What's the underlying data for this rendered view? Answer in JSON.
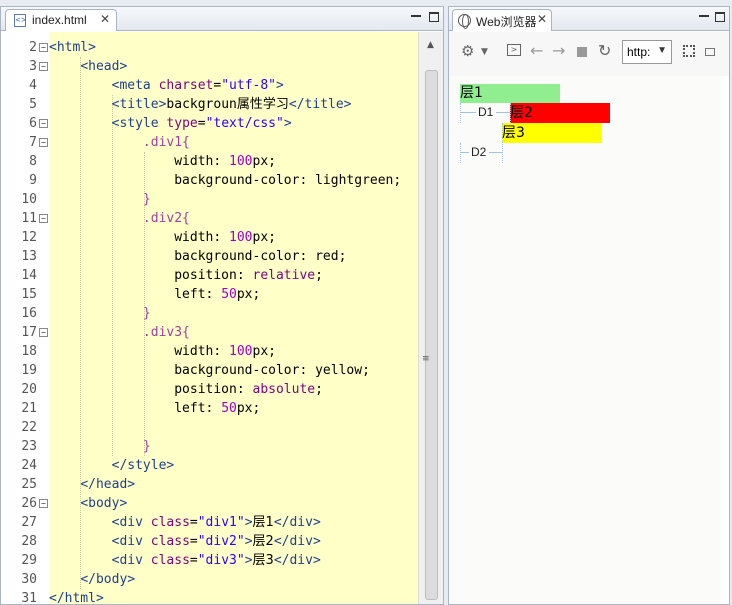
{
  "editor": {
    "tab_label": "index.html",
    "close_glyph": "✕",
    "lines": [
      {
        "n": "2",
        "fold": true
      },
      {
        "n": "3",
        "fold": true
      },
      {
        "n": "4"
      },
      {
        "n": "5"
      },
      {
        "n": "6",
        "fold": true
      },
      {
        "n": "7",
        "fold": true
      },
      {
        "n": "8"
      },
      {
        "n": "9"
      },
      {
        "n": "10"
      },
      {
        "n": "11",
        "fold": true
      },
      {
        "n": "12"
      },
      {
        "n": "13"
      },
      {
        "n": "14"
      },
      {
        "n": "15"
      },
      {
        "n": "16"
      },
      {
        "n": "17",
        "fold": true
      },
      {
        "n": "18"
      },
      {
        "n": "19"
      },
      {
        "n": "20"
      },
      {
        "n": "21"
      },
      {
        "n": "22"
      },
      {
        "n": "23"
      },
      {
        "n": "24"
      },
      {
        "n": "25"
      },
      {
        "n": "26",
        "fold": true
      },
      {
        "n": "27"
      },
      {
        "n": "28"
      },
      {
        "n": "29"
      },
      {
        "n": "30"
      },
      {
        "n": "31"
      }
    ],
    "code": [
      [
        [
          "tag",
          "<html>"
        ]
      ],
      [
        [
          "",
          "    "
        ],
        [
          "tag",
          "<head>"
        ]
      ],
      [
        [
          "",
          "        "
        ],
        [
          "tag",
          "<meta "
        ],
        [
          "attr",
          "charset"
        ],
        [
          "",
          "="
        ],
        [
          "str",
          "\"utf-8\""
        ],
        [
          "tag",
          ">"
        ]
      ],
      [
        [
          "",
          "        "
        ],
        [
          "tag",
          "<title>"
        ],
        [
          "",
          "backgroun"
        ],
        [
          "cjk",
          "属性学习"
        ],
        [
          "tag",
          "</title>"
        ]
      ],
      [
        [
          "",
          "        "
        ],
        [
          "tag",
          "<style "
        ],
        [
          "attr",
          "type"
        ],
        [
          "",
          "="
        ],
        [
          "str",
          "\"text/css\""
        ],
        [
          "tag",
          ">"
        ]
      ],
      [
        [
          "",
          "            "
        ],
        [
          "sel",
          ".div1{"
        ]
      ],
      [
        [
          "",
          "                width: "
        ],
        [
          "num",
          "100"
        ],
        [
          "",
          "px;"
        ]
      ],
      [
        [
          "",
          "                background-color: lightgreen;"
        ]
      ],
      [
        [
          "",
          "            "
        ],
        [
          "sel",
          "}"
        ]
      ],
      [
        [
          "",
          "            "
        ],
        [
          "sel",
          ".div2{"
        ]
      ],
      [
        [
          "",
          "                width: "
        ],
        [
          "num",
          "100"
        ],
        [
          "",
          "px;"
        ]
      ],
      [
        [
          "",
          "                background-color: red;"
        ]
      ],
      [
        [
          "",
          "                position: "
        ],
        [
          "attr",
          "relative"
        ],
        [
          "",
          ";"
        ]
      ],
      [
        [
          "",
          "                left: "
        ],
        [
          "num",
          "50"
        ],
        [
          "",
          "px;"
        ]
      ],
      [
        [
          "",
          "            "
        ],
        [
          "sel",
          "}"
        ]
      ],
      [
        [
          "",
          "            "
        ],
        [
          "sel",
          ".div3{"
        ]
      ],
      [
        [
          "",
          "                width: "
        ],
        [
          "num",
          "100"
        ],
        [
          "",
          "px;"
        ]
      ],
      [
        [
          "",
          "                background-color: yellow;"
        ]
      ],
      [
        [
          "",
          "                position: "
        ],
        [
          "attr",
          "absolute"
        ],
        [
          "",
          ";"
        ]
      ],
      [
        [
          "",
          "                left: "
        ],
        [
          "num",
          "50"
        ],
        [
          "",
          "px;"
        ]
      ],
      [
        [
          "",
          ""
        ]
      ],
      [
        [
          "",
          "            "
        ],
        [
          "sel",
          "}"
        ]
      ],
      [
        [
          "",
          "        "
        ],
        [
          "tag",
          "</style>"
        ]
      ],
      [
        [
          "",
          "    "
        ],
        [
          "tag",
          "</head>"
        ]
      ],
      [
        [
          "",
          "    "
        ],
        [
          "tag",
          "<body>"
        ]
      ],
      [
        [
          "",
          "        "
        ],
        [
          "tag",
          "<div "
        ],
        [
          "attr",
          "class"
        ],
        [
          "",
          "="
        ],
        [
          "str",
          "\"div1\""
        ],
        [
          "tag",
          ">"
        ],
        [
          "cjk",
          "层1"
        ],
        [
          "tag",
          "</div>"
        ]
      ],
      [
        [
          "",
          "        "
        ],
        [
          "tag",
          "<div "
        ],
        [
          "attr",
          "class"
        ],
        [
          "",
          "="
        ],
        [
          "str",
          "\"div2\""
        ],
        [
          "tag",
          ">"
        ],
        [
          "cjk",
          "层2"
        ],
        [
          "tag",
          "</div>"
        ]
      ],
      [
        [
          "",
          "        "
        ],
        [
          "tag",
          "<div "
        ],
        [
          "attr",
          "class"
        ],
        [
          "",
          "="
        ],
        [
          "str",
          "\"div3\""
        ],
        [
          "tag",
          ">"
        ],
        [
          "cjk",
          "层3"
        ],
        [
          "tag",
          "</div>"
        ]
      ],
      [
        [
          "",
          "    "
        ],
        [
          "tag",
          "</body>"
        ]
      ],
      [
        [
          "tag",
          "</html>"
        ]
      ]
    ]
  },
  "browser": {
    "tab_label": "Web浏览器",
    "close_glyph": "✕",
    "url_value": "http:",
    "toolbar_icons": [
      "gear-icon",
      "terminal-icon",
      "back-icon",
      "forward-icon",
      "stop-icon",
      "refresh-icon",
      "qr-icon",
      "lock-icon"
    ],
    "page": {
      "div1_text": "层1",
      "div2_text": "层2",
      "div3_text": "层3",
      "d1_label": "D1",
      "d2_label": "D2"
    }
  }
}
